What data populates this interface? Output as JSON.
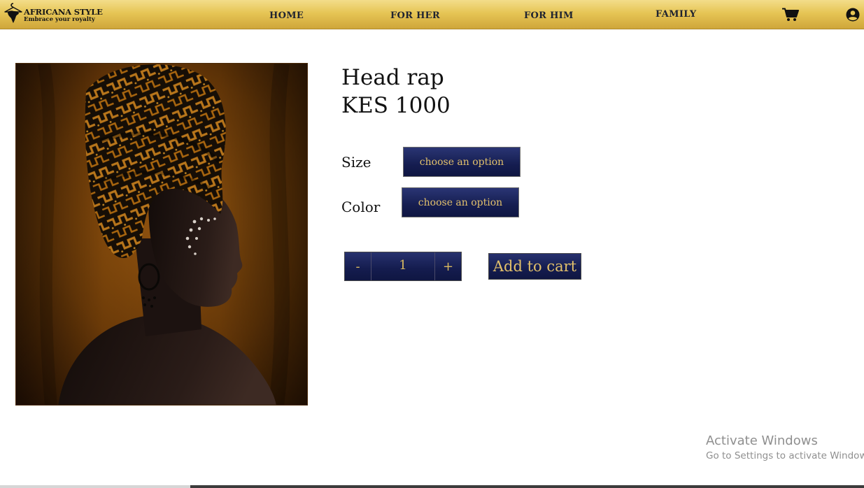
{
  "brand": {
    "name": "AFRICANA STYLE",
    "tagline": "Embrace your royalty",
    "logo_icon": "hanger-africa-icon"
  },
  "nav": {
    "items": [
      {
        "label": "HOME"
      },
      {
        "label": "FOR HER"
      },
      {
        "label": "FOR HIM"
      },
      {
        "label": "FAMILY"
      }
    ],
    "cart_icon": "shopping-cart-icon",
    "account_icon": "user-circle-icon"
  },
  "product": {
    "name": "Head rap",
    "price": "KES 1000",
    "image_icon": "woman-headwrap-photo"
  },
  "options": {
    "size_label": "Size",
    "size_value": "choose an option",
    "color_label": "Color",
    "color_value": "choose an option"
  },
  "quantity": {
    "minus": "-",
    "value": "1",
    "plus": "+"
  },
  "actions": {
    "add_to_cart": "Add to cart"
  },
  "watermark": {
    "title": "Activate Windows",
    "subtitle": "Go to Settings to activate Windows."
  },
  "colors": {
    "header_gold": "#e6c555",
    "button_navy": "#151d50",
    "button_text_gold": "#e2c06b"
  }
}
